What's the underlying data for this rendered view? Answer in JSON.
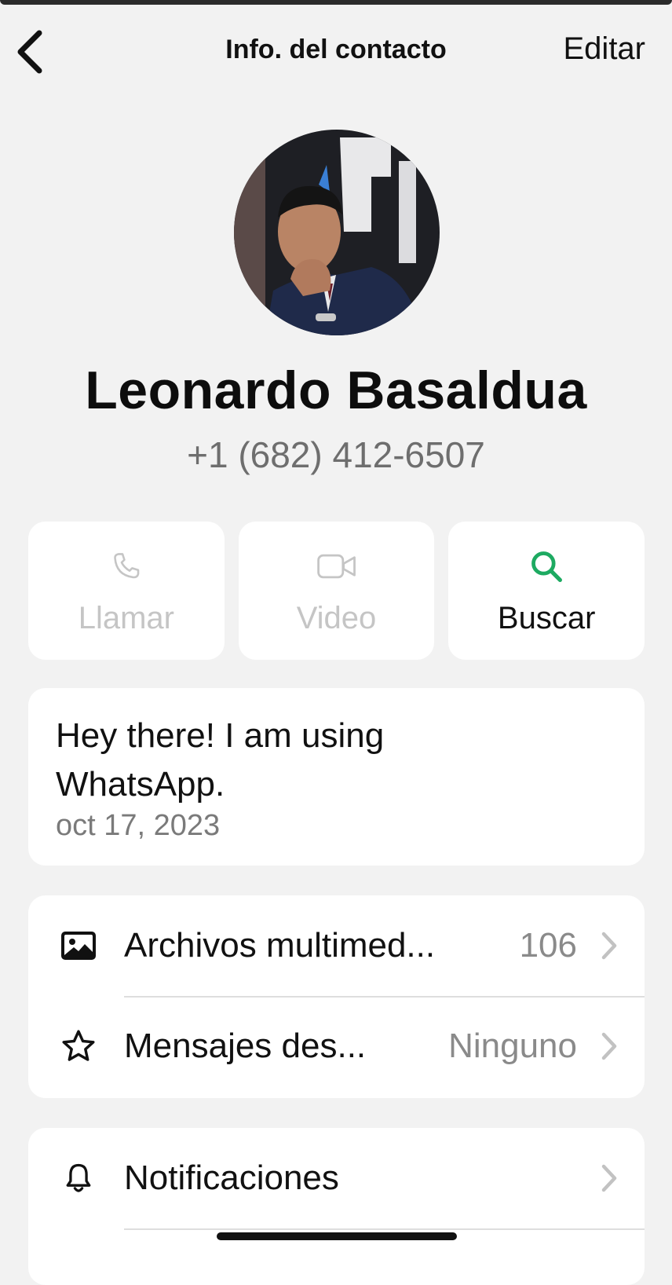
{
  "header": {
    "title": "Info. del contacto",
    "edit_label": "Editar",
    "back_icon": "chevron-left-icon"
  },
  "contact": {
    "name": "Leonardo Basaldua",
    "phone": "+1 (682) 412-6507",
    "avatar_icon": "profile-photo"
  },
  "actions": [
    {
      "label": "Llamar",
      "icon": "phone-icon",
      "enabled": false
    },
    {
      "label": "Video",
      "icon": "video-camera-icon",
      "enabled": false
    },
    {
      "label": "Buscar",
      "icon": "search-icon",
      "enabled": true
    }
  ],
  "status": {
    "text": "Hey there! I am using WhatsApp.",
    "date": "oct 17, 2023"
  },
  "media_section": {
    "rows": [
      {
        "label": "Archivos multimed...",
        "value": "106",
        "icon": "photo-icon"
      },
      {
        "label": "Mensajes des...",
        "value": "Ninguno",
        "icon": "star-icon"
      }
    ]
  },
  "settings_section": {
    "rows": [
      {
        "label": "Notificaciones",
        "value": "",
        "icon": "bell-icon"
      }
    ]
  },
  "colors": {
    "background": "#f2f2f2",
    "card": "#ffffff",
    "accent_green": "#1daa61",
    "disabled_text": "#c5c5c5",
    "secondary_text": "#7a7a7a"
  }
}
